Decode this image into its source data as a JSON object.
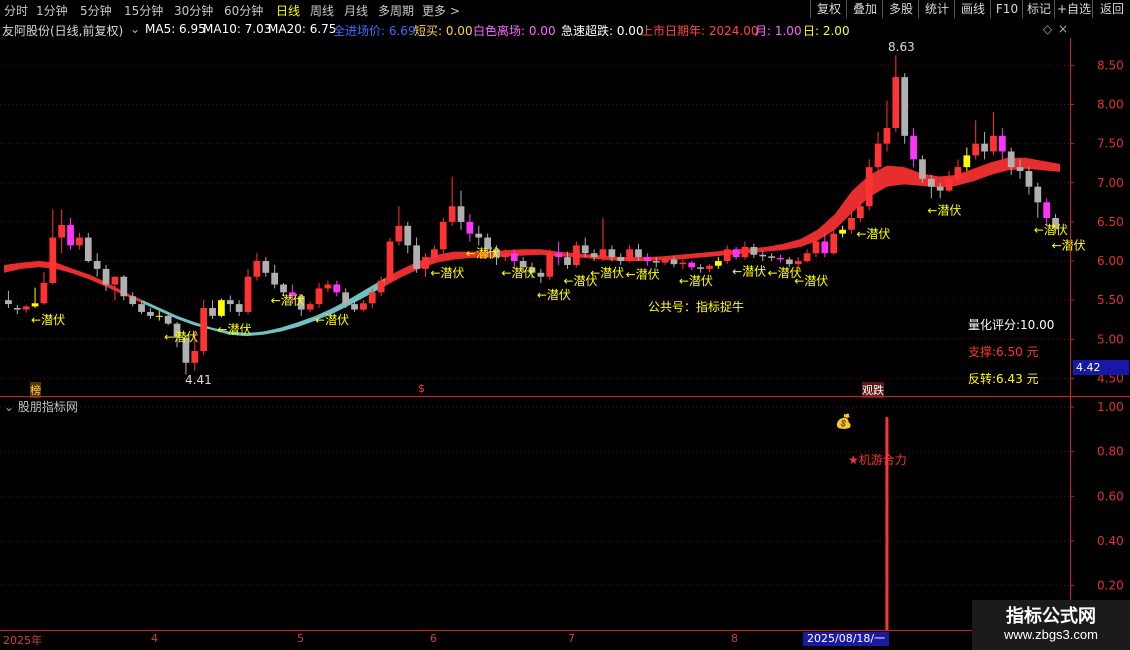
{
  "toolbar": {
    "periods": [
      "分时",
      "1分钟",
      "5分钟",
      "15分钟",
      "30分钟",
      "60分钟",
      "日线",
      "周线",
      "月线",
      "多周期",
      "更多 >"
    ],
    "active_period": "日线",
    "right_buttons": [
      "复权",
      "叠加",
      "多股",
      "统计",
      "画线",
      "F10",
      "标记",
      "+自选",
      "返回"
    ]
  },
  "legend": {
    "title": "友阿股份(日线,前复权)",
    "ma5": "MA5: 6.95",
    "ma10": "MA10: 7.03",
    "ma20": "MA20: 6.75",
    "field1": "全进场价: 6.69",
    "field2": "短买: 0.00",
    "field3": "白色离场: 0.00",
    "field4": "急速超跌: 0.00",
    "field5": "上市日期年: 2024.00",
    "field6": "月: 1.00",
    "field7": "日: 2.00"
  },
  "colors": {
    "up": "#ff3333",
    "down_gray": "#b0b0b0",
    "magenta": "#ff33ff",
    "yellow": "#ffff00",
    "cyan": "#55dddd",
    "grid": "#7a0000",
    "axis": "#cc2222"
  },
  "main_chart": {
    "y_ticks": [
      "8.50",
      "8.00",
      "7.50",
      "7.00",
      "6.50",
      "6.00",
      "5.50",
      "5.00",
      "4.50"
    ],
    "high_label": "8.63",
    "low_label": "4.41",
    "current_price": "4.42",
    "signal_text": "←潜伏",
    "center_note": "公共号：指标捉牛",
    "score_label": "量化评分:10.00",
    "support_label": "支撑:6.50 元",
    "reversal_label": "反转:6.43 元",
    "markers": [
      "榜",
      "$",
      "观跌"
    ]
  },
  "sub_chart": {
    "title": "股朋指标网",
    "y_ticks": [
      "1.00",
      "0.80",
      "0.60",
      "0.40",
      "0.20"
    ],
    "signal_label": "★机游合力"
  },
  "x_axis": {
    "labels": [
      "2025年",
      "4",
      "5",
      "6",
      "7",
      "8"
    ],
    "cursor_date": "2025/08/18/一"
  },
  "watermark": {
    "line1": "指标公式网",
    "line2": "www.zbgs3.com"
  },
  "chart_data": {
    "type": "candlestick",
    "y_range": [
      4.25,
      8.85
    ],
    "sub_y_range": [
      0,
      1.05
    ],
    "candles": [
      [
        5.5,
        5.62,
        5.45,
        5.4
      ],
      [
        5.4,
        5.44,
        5.38,
        5.32
      ],
      [
        5.38,
        5.44,
        5.42,
        5.34
      ],
      [
        5.42,
        5.66,
        5.46,
        5.4
      ],
      [
        5.46,
        5.86,
        5.72,
        5.44
      ],
      [
        5.72,
        6.66,
        6.3,
        5.7
      ],
      [
        6.3,
        6.66,
        6.46,
        6.1
      ],
      [
        6.46,
        6.55,
        6.2,
        6.15
      ],
      [
        6.2,
        6.36,
        6.3,
        6.15
      ],
      [
        6.3,
        6.36,
        6.0,
        5.98
      ],
      [
        6.0,
        6.1,
        5.9,
        5.8
      ],
      [
        5.9,
        5.95,
        5.7,
        5.62
      ],
      [
        5.7,
        5.8,
        5.8,
        5.5
      ],
      [
        5.8,
        5.82,
        5.55,
        5.5
      ],
      [
        5.55,
        5.6,
        5.45,
        5.42
      ],
      [
        5.45,
        5.5,
        5.35,
        5.32
      ],
      [
        5.35,
        5.4,
        5.3,
        5.26
      ],
      [
        5.3,
        5.36,
        5.3,
        5.24
      ],
      [
        5.3,
        5.34,
        5.2,
        5.18
      ],
      [
        5.2,
        5.22,
        5.02,
        4.9
      ],
      [
        5.02,
        5.06,
        4.7,
        4.55
      ],
      [
        4.7,
        5.1,
        4.85,
        4.6
      ],
      [
        4.85,
        5.5,
        5.4,
        4.8
      ],
      [
        5.4,
        5.5,
        5.3,
        5.26
      ],
      [
        5.3,
        5.52,
        5.5,
        5.28
      ],
      [
        5.5,
        5.56,
        5.45,
        5.35
      ],
      [
        5.45,
        5.5,
        5.35,
        5.3
      ],
      [
        5.35,
        5.9,
        5.8,
        5.32
      ],
      [
        5.8,
        6.1,
        6.0,
        5.75
      ],
      [
        6.0,
        6.05,
        5.85,
        5.8
      ],
      [
        5.85,
        5.95,
        5.7,
        5.65
      ],
      [
        5.7,
        5.72,
        5.6,
        5.55
      ],
      [
        5.6,
        5.7,
        5.55,
        5.45
      ],
      [
        5.55,
        5.58,
        5.38,
        5.3
      ],
      [
        5.38,
        5.48,
        5.45,
        5.35
      ],
      [
        5.45,
        5.72,
        5.65,
        5.4
      ],
      [
        5.65,
        5.75,
        5.7,
        5.6
      ],
      [
        5.7,
        5.75,
        5.6,
        5.55
      ],
      [
        5.6,
        5.65,
        5.45,
        5.4
      ],
      [
        5.45,
        5.48,
        5.38,
        5.35
      ],
      [
        5.38,
        5.5,
        5.46,
        5.36
      ],
      [
        5.46,
        5.65,
        5.6,
        5.4
      ],
      [
        5.6,
        5.8,
        5.75,
        5.55
      ],
      [
        5.75,
        6.3,
        6.25,
        5.72
      ],
      [
        6.25,
        6.7,
        6.45,
        6.2
      ],
      [
        6.45,
        6.5,
        6.2,
        6.1
      ],
      [
        6.2,
        6.3,
        5.9,
        5.85
      ],
      [
        5.9,
        6.1,
        6.05,
        5.8
      ],
      [
        6.05,
        6.2,
        6.15,
        6.0
      ],
      [
        6.15,
        6.55,
        6.5,
        6.1
      ],
      [
        6.5,
        7.08,
        6.7,
        6.45
      ],
      [
        6.7,
        6.9,
        6.5,
        6.4
      ],
      [
        6.5,
        6.6,
        6.35,
        6.25
      ],
      [
        6.35,
        6.45,
        6.3,
        6.2
      ],
      [
        6.3,
        6.35,
        6.15,
        6.05
      ],
      [
        6.15,
        6.2,
        6.05,
        5.95
      ],
      [
        6.05,
        6.15,
        6.1,
        6.0
      ],
      [
        6.1,
        6.15,
        6.0,
        5.9
      ],
      [
        6.0,
        6.05,
        5.92,
        5.85
      ],
      [
        5.92,
        5.98,
        5.85,
        5.78
      ],
      [
        5.85,
        5.9,
        5.8,
        5.72
      ],
      [
        5.8,
        6.15,
        6.1,
        5.76
      ],
      [
        6.1,
        6.25,
        6.05,
        5.95
      ],
      [
        6.05,
        6.12,
        5.95,
        5.9
      ],
      [
        5.95,
        6.25,
        6.2,
        5.92
      ],
      [
        6.2,
        6.3,
        6.1,
        6.05
      ],
      [
        6.1,
        6.15,
        6.05,
        6.0
      ],
      [
        6.05,
        6.55,
        6.15,
        6.0
      ],
      [
        6.15,
        6.2,
        6.05,
        6.0
      ],
      [
        6.05,
        6.1,
        6.0,
        5.95
      ],
      [
        6.0,
        6.2,
        6.15,
        5.98
      ],
      [
        6.15,
        6.22,
        6.05,
        6.0
      ],
      [
        6.05,
        6.1,
        6.0,
        5.94
      ],
      [
        6.0,
        6.05,
        5.98,
        5.92
      ],
      [
        5.98,
        6.05,
        6.02,
        5.95
      ],
      [
        6.02,
        6.06,
        5.96,
        5.92
      ],
      [
        5.96,
        6.02,
        5.98,
        5.9
      ],
      [
        5.98,
        6.0,
        5.92,
        5.88
      ],
      [
        5.92,
        5.96,
        5.9,
        5.85
      ],
      [
        5.9,
        5.96,
        5.94,
        5.86
      ],
      [
        5.94,
        6.05,
        6.0,
        5.9
      ],
      [
        6.0,
        6.2,
        6.15,
        5.96
      ],
      [
        6.15,
        6.18,
        6.05,
        6.02
      ],
      [
        6.05,
        6.25,
        6.18,
        6.02
      ],
      [
        6.18,
        6.22,
        6.08,
        6.04
      ],
      [
        6.08,
        6.12,
        6.06,
        6.0
      ],
      [
        6.06,
        6.1,
        6.04,
        6.0
      ],
      [
        6.04,
        6.08,
        6.02,
        5.98
      ],
      [
        6.02,
        6.05,
        5.96,
        5.92
      ],
      [
        5.96,
        6.05,
        6.0,
        5.9
      ],
      [
        6.0,
        6.15,
        6.1,
        5.98
      ],
      [
        6.1,
        6.3,
        6.25,
        6.05
      ],
      [
        6.25,
        6.35,
        6.1,
        6.05
      ],
      [
        6.1,
        6.4,
        6.35,
        6.08
      ],
      [
        6.35,
        6.45,
        6.4,
        6.3
      ],
      [
        6.4,
        6.65,
        6.55,
        6.35
      ],
      [
        6.55,
        6.75,
        6.7,
        6.5
      ],
      [
        6.7,
        7.3,
        7.2,
        6.65
      ],
      [
        7.2,
        7.65,
        7.5,
        7.1
      ],
      [
        7.5,
        8.05,
        7.7,
        7.4
      ],
      [
        7.7,
        8.63,
        8.35,
        7.65
      ],
      [
        8.35,
        8.4,
        7.6,
        7.5
      ],
      [
        7.6,
        7.7,
        7.3,
        7.2
      ],
      [
        7.3,
        7.35,
        7.05,
        7.0
      ],
      [
        7.05,
        7.1,
        6.95,
        6.8
      ],
      [
        6.95,
        7.0,
        6.9,
        6.8
      ],
      [
        6.9,
        7.15,
        7.05,
        6.88
      ],
      [
        7.05,
        7.3,
        7.2,
        7.0
      ],
      [
        7.2,
        7.45,
        7.35,
        7.15
      ],
      [
        7.35,
        7.8,
        7.5,
        7.3
      ],
      [
        7.5,
        7.65,
        7.4,
        7.3
      ],
      [
        7.4,
        7.9,
        7.6,
        7.35
      ],
      [
        7.6,
        7.7,
        7.4,
        7.3
      ],
      [
        7.4,
        7.45,
        7.2,
        7.1
      ],
      [
        7.2,
        7.3,
        7.15,
        7.05
      ],
      [
        7.15,
        7.2,
        6.95,
        6.85
      ],
      [
        6.95,
        7.0,
        6.75,
        6.55
      ],
      [
        6.75,
        6.8,
        6.55,
        6.45
      ],
      [
        6.55,
        6.6,
        6.42,
        6.35
      ]
    ],
    "band_upper": [
      5.95,
      5.98,
      6.0,
      5.98,
      5.9,
      5.82,
      5.72,
      5.6,
      5.5,
      5.4,
      5.3,
      5.22,
      5.15,
      5.1,
      5.08,
      5.1,
      5.15,
      5.22,
      5.3,
      5.4,
      5.52,
      5.65,
      5.78,
      5.9,
      6.0,
      6.08,
      6.12,
      6.12,
      6.12,
      6.14,
      6.15,
      6.15,
      6.12,
      6.1,
      6.08,
      6.06,
      6.05,
      6.05,
      6.06,
      6.08,
      6.1,
      6.12,
      6.14,
      6.16,
      6.18,
      6.22,
      6.28,
      6.4,
      6.6,
      6.9,
      7.1,
      7.22,
      7.2,
      7.12,
      7.08,
      7.1,
      7.18,
      7.26,
      7.32,
      7.32,
      7.28,
      7.24
    ],
    "band_lower": [
      5.85,
      5.9,
      5.92,
      5.9,
      5.84,
      5.76,
      5.66,
      5.56,
      5.46,
      5.36,
      5.26,
      5.18,
      5.12,
      5.06,
      5.04,
      5.06,
      5.1,
      5.16,
      5.24,
      5.33,
      5.44,
      5.56,
      5.68,
      5.8,
      5.9,
      5.98,
      6.02,
      6.04,
      6.04,
      6.06,
      6.07,
      6.08,
      6.06,
      6.05,
      6.03,
      6.01,
      6.0,
      6.0,
      6.01,
      6.02,
      6.04,
      6.06,
      6.08,
      6.1,
      6.12,
      6.14,
      6.18,
      6.26,
      6.4,
      6.62,
      6.82,
      6.95,
      6.98,
      6.96,
      6.94,
      6.96,
      7.02,
      7.1,
      7.16,
      7.18,
      7.16,
      7.14
    ],
    "signal_positions": [
      3,
      18,
      24,
      30,
      35,
      48,
      52,
      56,
      60,
      63,
      66,
      70,
      76,
      82,
      86,
      89,
      96,
      104,
      116,
      118
    ],
    "sub_signal": {
      "index": 99,
      "value": 1.0
    }
  }
}
